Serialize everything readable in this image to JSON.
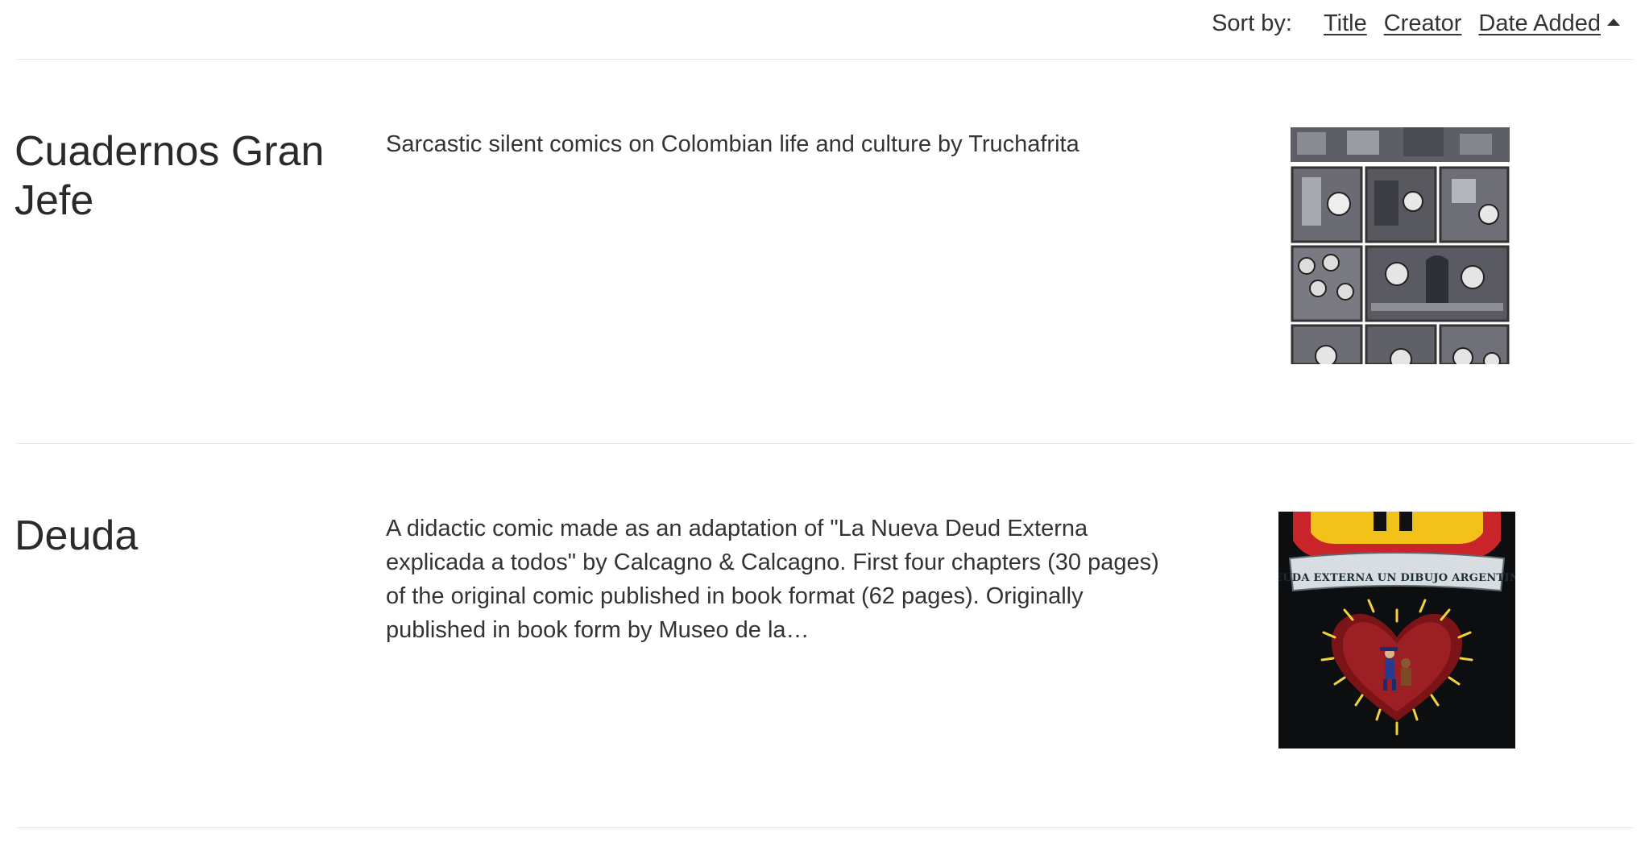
{
  "sort": {
    "label": "Sort by:",
    "options": [
      "Title",
      "Creator",
      "Date Added"
    ],
    "active": "Date Added",
    "direction": "ascending"
  },
  "items": [
    {
      "title": "Cuadernos Gran Jefe",
      "description": "Sarcastic silent comics on Colombian life and culture by Truchafrita",
      "thumbnail": "comic-panels-grayscale"
    },
    {
      "title": "Deuda",
      "description": "A didactic comic made as an adaptation of \"La Nueva Deud Externa explicada a todos\" by Calcagno & Calcagno. First four chapters (30 pages) of the original comic published in book format (62 pages). Originally published in book form by Museo de la…",
      "thumbnail": "deuda-cover",
      "cover_text": "DEUDA EXTERNA UN DIBUJO ARGENTINO"
    }
  ],
  "colors": {
    "text": "#333333",
    "divider": "#e6e6e6",
    "cover_background": "#0c0e10",
    "heart": "#8b1c1c"
  }
}
